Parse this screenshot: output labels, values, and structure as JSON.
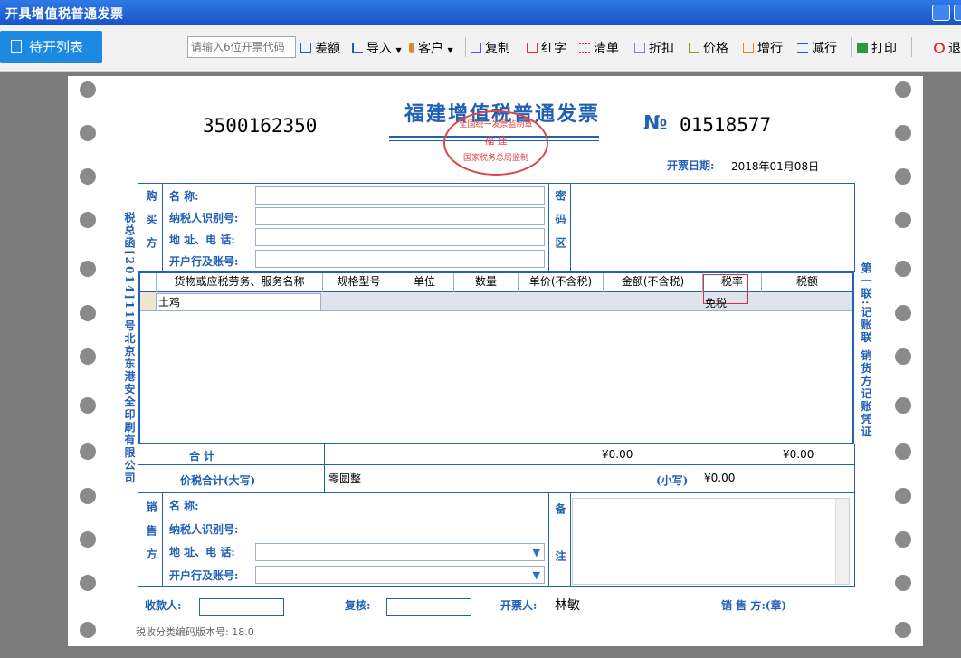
{
  "window": {
    "title": "开具增值税普通发票"
  },
  "toolbar": {
    "pending_label": "待开列表",
    "code_placeholder": "请输入6位开票代码",
    "buttons": [
      "差额",
      "导入",
      "客户",
      "复制",
      "红字",
      "清单",
      "折扣",
      "价格",
      "增行",
      "减行",
      "打印",
      "退"
    ]
  },
  "invoice": {
    "title": "福建增值税普通发票",
    "code": "3500162350",
    "number_symbol": "№",
    "number": "01518577",
    "stamp_top": "全国统一发票监制章",
    "stamp_middle": "福 建",
    "stamp_bottom": "国家税务总局监制",
    "date_label": "开票日期:",
    "date_value": "2018年01月08日",
    "buyer_label": "购买方",
    "buyer_fields": [
      "名        称:",
      "纳税人识别号:",
      "地 址、电 话:",
      "开户行及账号:"
    ],
    "cipher_label": "密码区",
    "columns": [
      "货物或应税劳务、服务名称",
      "规格型号",
      "单位",
      "数量",
      "单价(不含税)",
      "金额(不含税)",
      "税率",
      "税额"
    ],
    "row_item": "土鸡",
    "row_rate": "免税",
    "total_label": "合        计",
    "total_amount": "¥0.00",
    "total_tax": "¥0.00",
    "tax_total_label": "价税合计(大写)",
    "tax_total_upper": "零圆整",
    "small_label": "(小写)",
    "small_value": "¥0.00",
    "seller_label": "销售方",
    "seller_fields": [
      "名        称:",
      "纳税人识别号:",
      "地 址、电 话:",
      "开户行及账号:"
    ],
    "remark_label": "备注",
    "left_vertical": "税总函[2014]11号北京东港安全印刷有限公司",
    "right_vertical": "第一联:记账联 销货方记账凭证",
    "payee_label": "收款人:",
    "reviewer_label": "复核:",
    "drawer_label": "开票人:",
    "drawer_value": "林敏",
    "seller_seal_label": "销 售 方:(章)",
    "version_label": "税收分类编码版本号:",
    "version_value": "18.0"
  },
  "colors": {
    "titlebar": "#1754c7",
    "pending_button": "#1c8ae3",
    "invoice_blue": "#2160b4",
    "stamp_red": "#e04545"
  }
}
